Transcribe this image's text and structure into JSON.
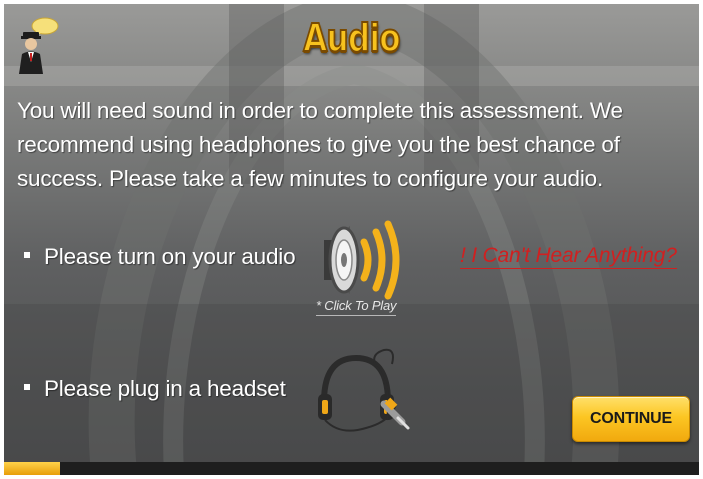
{
  "header": {
    "title": "Audio",
    "avatar_icon": "butler-with-speech-bubble-icon"
  },
  "intro": {
    "text": "You will need sound in order to complete this assessment. We recommend using headphones to give you the best chance of success. Please take a few minutes to configure your audio."
  },
  "steps": [
    {
      "label": "Please turn on your audio",
      "icon": "speaker-icon",
      "action_label": "* Click To Play"
    },
    {
      "label": "Please plug in a headset",
      "icon": "headphones-icon"
    }
  ],
  "help_link": {
    "label": "! I Can't Hear Anything?"
  },
  "continue_button": {
    "label": "CONTINUE"
  },
  "progress": {
    "fraction": 0.08
  },
  "colors": {
    "title_yellow": "#f7c21e",
    "help_red": "#d02020",
    "button_yellow": "#fcc623",
    "progress_yellow": "#f0b41c",
    "text_white": "#ffffff"
  }
}
